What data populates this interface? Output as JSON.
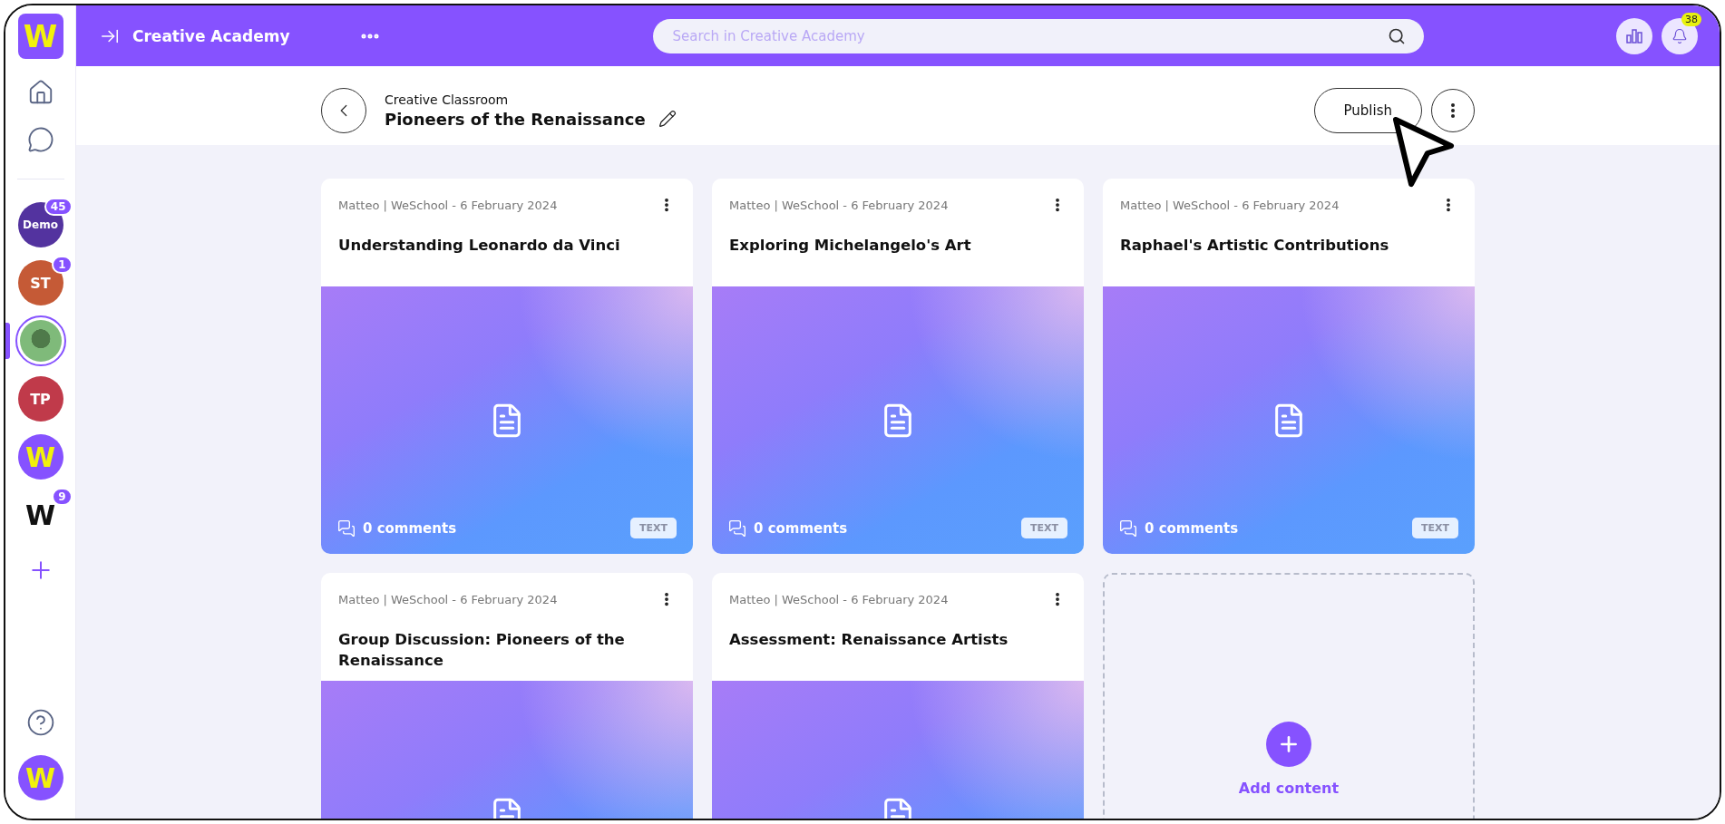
{
  "sidebar": {
    "logo": "W",
    "items": [
      {
        "kind": "initials",
        "label": "Demo",
        "badge": "45",
        "color": "#53339f",
        "selected": false
      },
      {
        "kind": "initials",
        "label": "ST",
        "badge": "1",
        "color": "#c55a36",
        "selected": false
      },
      {
        "kind": "photo",
        "selected": true
      },
      {
        "kind": "initials",
        "label": "TP",
        "color": "#c03a4a",
        "selected": false
      },
      {
        "kind": "logo",
        "label": "W",
        "selected": false
      },
      {
        "kind": "wordmark",
        "label": "W",
        "badge": "9",
        "selected": false
      }
    ],
    "account": "W"
  },
  "topbar": {
    "title": "Creative Academy",
    "search": {
      "placeholder": "Search in Creative Academy"
    },
    "notifications": "38"
  },
  "header": {
    "breadcrumb": "Creative Classroom",
    "title": "Pioneers of the Renaissance",
    "publish": "Publish"
  },
  "cards": [
    {
      "meta": "Matteo | WeSchool - 6 February 2024",
      "title": "Understanding Leonardo da Vinci",
      "comments": "0 comments",
      "tag": "TEXT"
    },
    {
      "meta": "Matteo | WeSchool - 6 February 2024",
      "title": "Exploring Michelangelo's Art",
      "comments": "0 comments",
      "tag": "TEXT"
    },
    {
      "meta": "Matteo | WeSchool - 6 February 2024",
      "title": "Raphael's Artistic Contributions",
      "comments": "0 comments",
      "tag": "TEXT"
    },
    {
      "meta": "Matteo | WeSchool - 6 February 2024",
      "title": "Group Discussion: Pioneers of the Renaissance"
    },
    {
      "meta": "Matteo | WeSchool - 6 February 2024",
      "title": "Assessment: Renaissance Artists"
    }
  ],
  "add_card": {
    "label": "Add content"
  }
}
